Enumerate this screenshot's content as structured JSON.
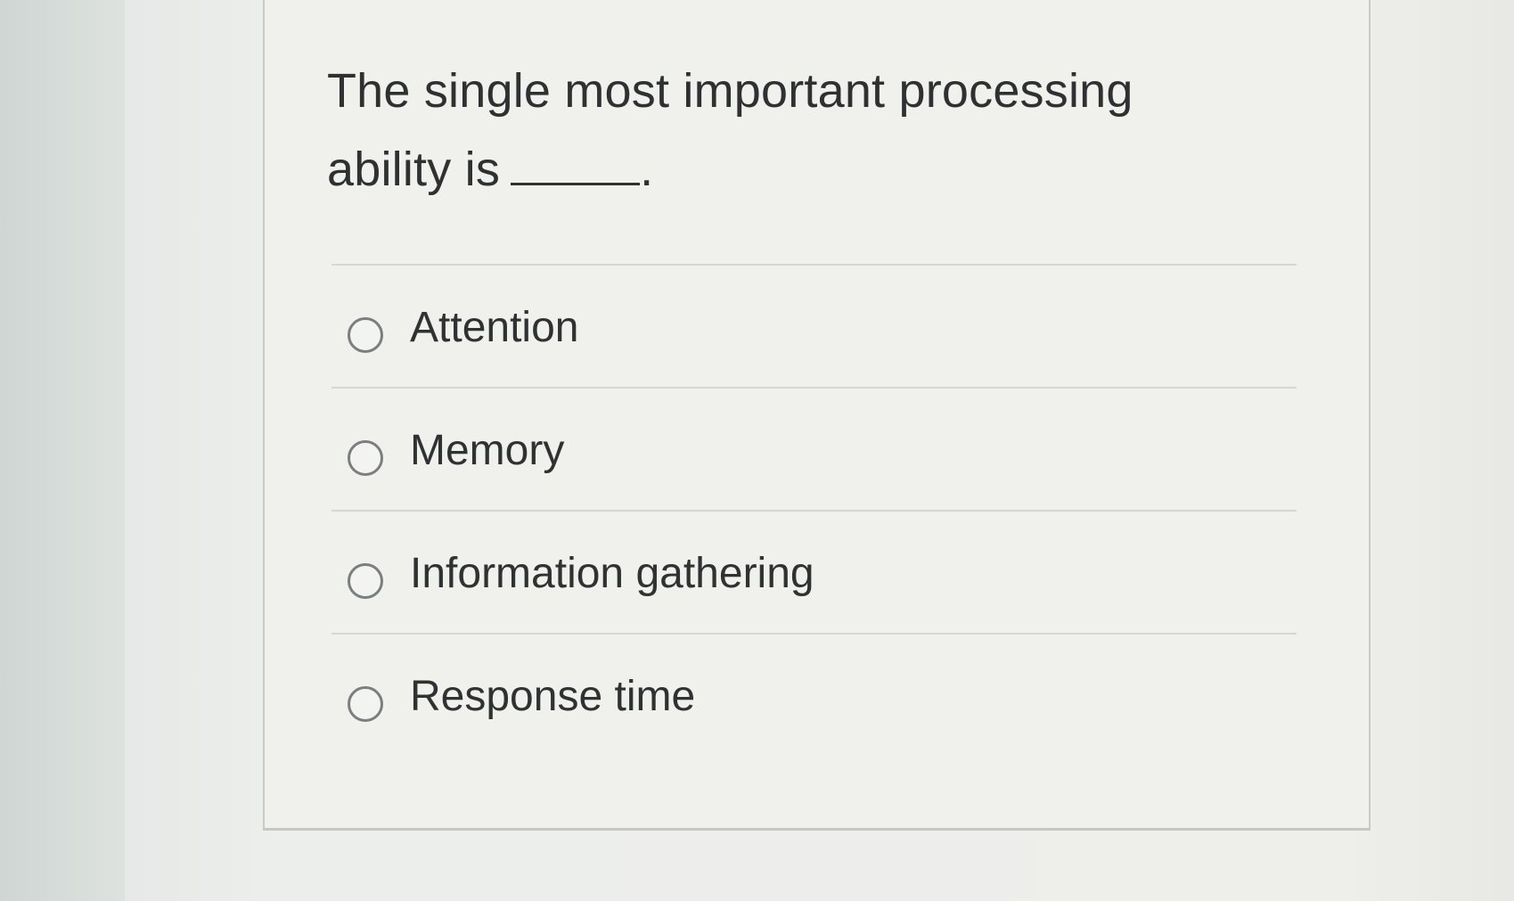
{
  "question": {
    "text_line1": "The single most important processing",
    "text_line2": "ability is",
    "blank_suffix": "."
  },
  "answers": [
    {
      "label": "Attention",
      "selected": false
    },
    {
      "label": "Memory",
      "selected": false
    },
    {
      "label": "Information gathering",
      "selected": false
    },
    {
      "label": "Response time",
      "selected": false
    }
  ]
}
